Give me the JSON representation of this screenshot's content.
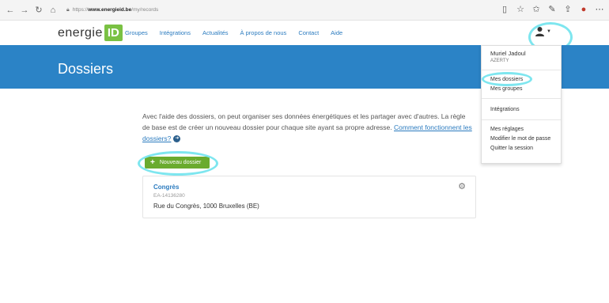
{
  "browser": {
    "back": "←",
    "forward": "→",
    "refresh": "↻",
    "home": "⌂",
    "url_prefix": "https://",
    "url_host": "www.energieid.be",
    "url_path": "/my/records",
    "icons": [
      "reader-icon",
      "star-icon",
      "favorites-icon",
      "pen-icon",
      "share-icon",
      "extension-icon",
      "more-icon"
    ]
  },
  "nav": {
    "logo_text": "energie",
    "logo_box": "ID",
    "links": [
      "Groupes",
      "Intégrations",
      "Actualités",
      "À propos de nous",
      "Contact",
      "Aide"
    ],
    "user_icon": "user-icon"
  },
  "hero": {
    "title": "Dossiers"
  },
  "intro": {
    "text": "Avec l'aide des dossiers, on peut organiser ses données énergétiques et les partager avec d'autres. La règle de base est de créer un nouveau dossier pour chaque site ayant sa propre adresse. ",
    "link": "Comment fonctionnent les dossiers?"
  },
  "new_button": {
    "label": "Nouveau dossier"
  },
  "records": [
    {
      "title": "Congrès",
      "id": "EA-14136280",
      "address": "Rue du Congrès, 1000 Bruxelles (BE)"
    }
  ],
  "dropdown": {
    "user_name": "Muriel Jadoul",
    "user_sub": "AZERTY",
    "items": [
      "Mes dossiers",
      "Mes groupes",
      "Intégrations",
      "Mes réglages",
      "Modifier le mot de passe",
      "Quitter la session"
    ]
  },
  "colors": {
    "brand_green": "#7ac143",
    "hero_blue": "#2b83c6",
    "link_blue": "#2b7bbf",
    "highlight": "#7ee6ef"
  }
}
